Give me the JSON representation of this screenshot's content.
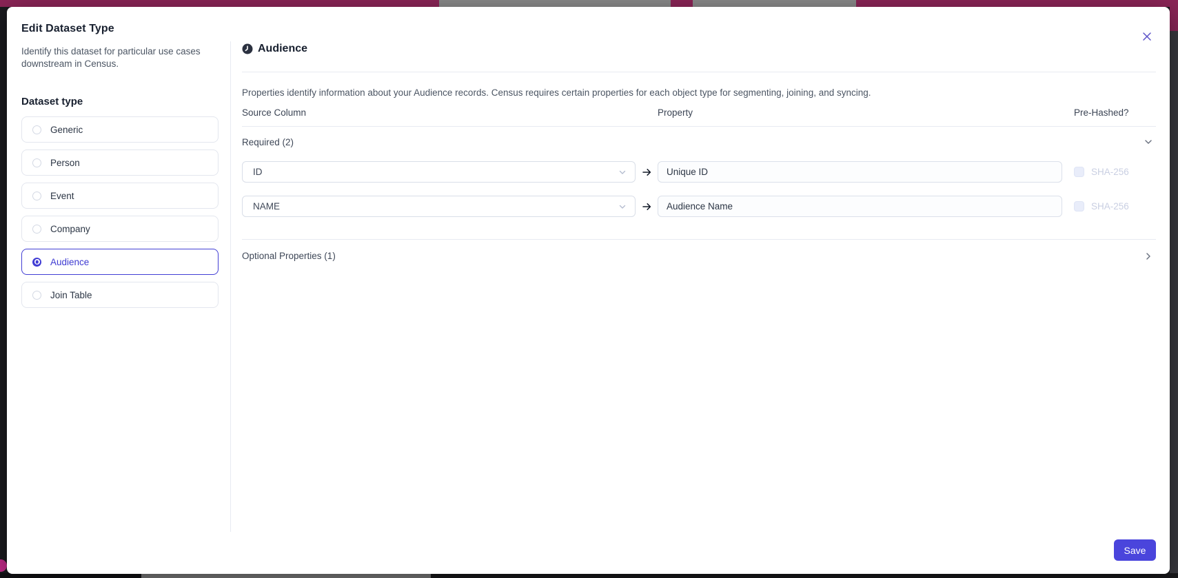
{
  "modal": {
    "title": "Edit Dataset Type",
    "description": "Identify this dataset for particular use cases downstream in Census."
  },
  "sidebar": {
    "section_label": "Dataset type",
    "options": [
      {
        "label": "Generic",
        "selected": false
      },
      {
        "label": "Person",
        "selected": false
      },
      {
        "label": "Event",
        "selected": false
      },
      {
        "label": "Company",
        "selected": false
      },
      {
        "label": "Audience",
        "selected": true
      },
      {
        "label": "Join Table",
        "selected": false
      }
    ]
  },
  "panel": {
    "title": "Audience",
    "description": "Properties identify information about your Audience records. Census requires certain properties for each object type for segmenting, joining, and syncing.",
    "columns": [
      "Source Column",
      "Property",
      "Pre-Hashed?"
    ],
    "required": {
      "label": "Required (2)",
      "rows": [
        {
          "source_column": "ID",
          "property": "Unique ID",
          "hash_label": "SHA-256",
          "hash_checked": false
        },
        {
          "source_column": "NAME",
          "property": "Audience Name",
          "hash_label": "SHA-256",
          "hash_checked": false
        }
      ]
    },
    "optional": {
      "label": "Optional Properties (1)"
    }
  },
  "footer": {
    "save_label": "Save"
  },
  "icons": {
    "panel_title": "clock-icon",
    "close": "close-icon",
    "required_toggle": "chevron-down-icon",
    "optional_toggle": "chevron-right-icon",
    "mapping": "arrow-right-icon",
    "select_caret": "chevron-down-icon"
  },
  "colors": {
    "accent": "#413DD4",
    "save_button": "#4A45DC",
    "top_bar_maroon": "#8B2557",
    "top_bar_gray": "#8A8A8A",
    "disabled_text": "#C9CFE2",
    "border": "#E7EAF1"
  }
}
